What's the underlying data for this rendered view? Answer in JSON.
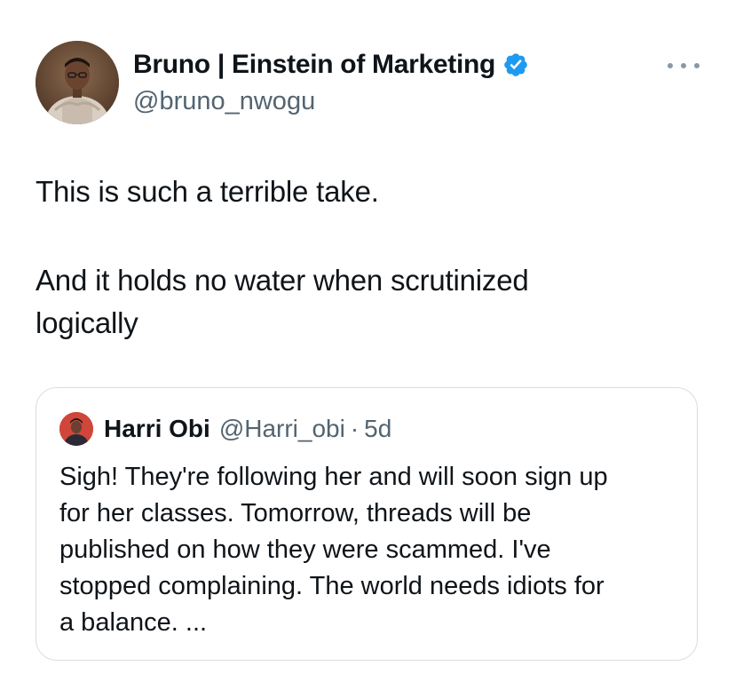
{
  "tweet": {
    "author": {
      "display_name": "Bruno | Einstein of Marketing",
      "handle": "@bruno_nwogu",
      "verified": true,
      "avatar_icon": "profile-photo"
    },
    "more_icon": "ellipsis-icon",
    "text_lines": [
      "This is such a terrible take.",
      "And it holds no water when scrutinized",
      "logically"
    ],
    "quote": {
      "author_name": "Harri Obi",
      "handle": "@Harri_obi",
      "separator": "·",
      "time": "5d",
      "text_lines": [
        "Sigh! They're following her and will soon sign up",
        "for her classes. Tomorrow, threads will be",
        "published on how they were scammed. I've",
        "stopped complaining. The world needs idiots for",
        "a balance. ..."
      ]
    }
  },
  "colors": {
    "text_primary": "#0f1419",
    "text_secondary": "#536471",
    "verified_blue": "#1d9bf0",
    "border": "#d8dde2"
  }
}
